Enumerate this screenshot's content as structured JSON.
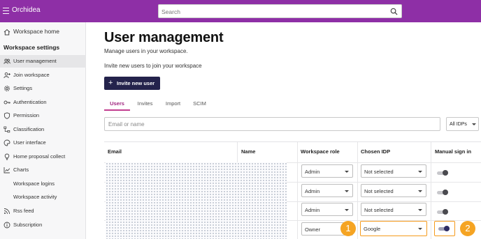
{
  "app": {
    "title": "Orchidea"
  },
  "search": {
    "placeholder": "Search"
  },
  "sidebar": {
    "home": "Workspace home",
    "section_heading": "Workspace settings",
    "items": [
      {
        "label": "User management",
        "icon": "users-icon",
        "active": true
      },
      {
        "label": "Join workspace",
        "icon": "person-add-icon"
      },
      {
        "label": "Settings",
        "icon": "gear-icon"
      },
      {
        "label": "Authentication",
        "icon": "key-icon"
      },
      {
        "label": "Permission",
        "icon": "shield-icon"
      },
      {
        "label": "Classification",
        "icon": "tree-icon"
      },
      {
        "label": "User interface",
        "icon": "palette-icon"
      },
      {
        "label": "Home proposal collect",
        "icon": "bulb-icon"
      },
      {
        "label": "Charts",
        "icon": "chart-icon"
      },
      {
        "label": "Workspace logins",
        "sub": true
      },
      {
        "label": "Workspace activity",
        "sub": true
      },
      {
        "label": "Rss feed",
        "icon": "rss-icon"
      },
      {
        "label": "Subscription",
        "icon": "info-icon"
      }
    ]
  },
  "main": {
    "title": "User management",
    "subtitle": "Manage users in your workspace.",
    "invite_text": "Invite new users to join your workspace",
    "invite_button": "Invite new user",
    "tabs": [
      {
        "label": "Users",
        "active": true
      },
      {
        "label": "Invites"
      },
      {
        "label": "Import"
      },
      {
        "label": "SCIM"
      }
    ],
    "filter_placeholder": "Email or name",
    "idp_filter": "All IDPs"
  },
  "table": {
    "columns": [
      "Email",
      "Name",
      "Workspace role",
      "Chosen IDP",
      "Manual sign in"
    ],
    "rows": [
      {
        "role": "Admin",
        "idp": "Not selected",
        "manual_signin": false
      },
      {
        "role": "Admin",
        "idp": "Not selected",
        "manual_signin": false
      },
      {
        "role": "Admin",
        "idp": "Not selected",
        "manual_signin": false
      },
      {
        "role": "Owner",
        "idp": "Google",
        "manual_signin": true
      }
    ]
  },
  "callouts": [
    "1",
    "2"
  ],
  "colors": {
    "topbar": "#8e2fa6",
    "accent": "#c23d8f",
    "button": "#24234c",
    "highlight": "#f59b1c"
  }
}
